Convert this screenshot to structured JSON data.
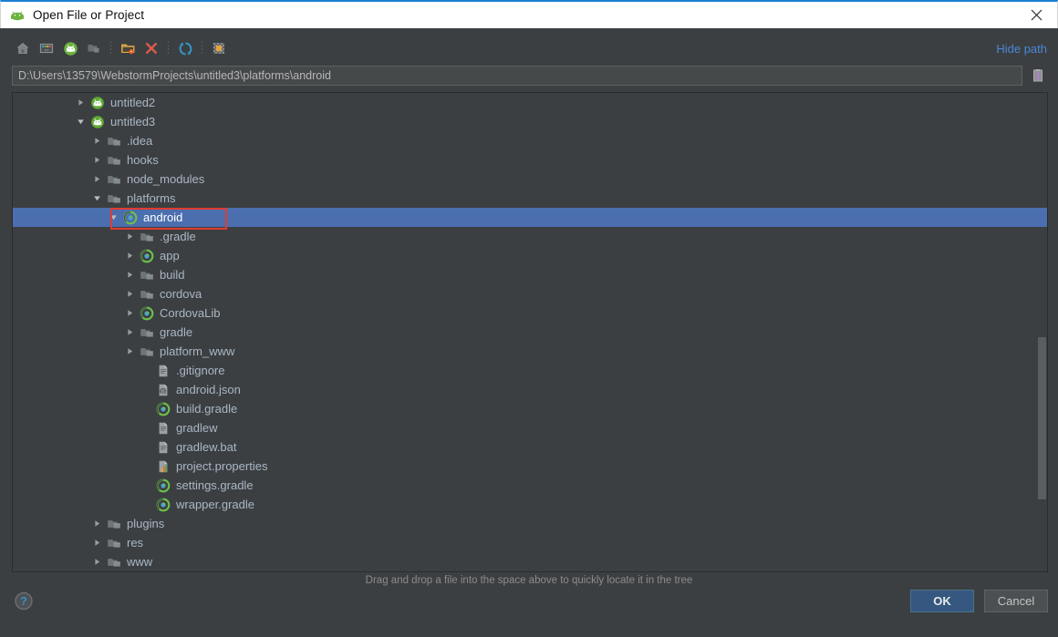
{
  "window": {
    "title": "Open File or Project",
    "app_icon": "android-icon",
    "close_icon": "close-icon",
    "accent_blue": "#1a7fd4"
  },
  "toolbar": {
    "buttons": [
      {
        "name": "home-icon",
        "tooltip": "Home"
      },
      {
        "name": "desktop-icon",
        "tooltip": "Desktop"
      },
      {
        "name": "android-project-icon",
        "tooltip": "Project Directory"
      },
      {
        "name": "folder-icon",
        "tooltip": "Module Directory"
      },
      {
        "name": "new-folder-icon",
        "tooltip": "New Folder"
      },
      {
        "name": "delete-icon",
        "tooltip": "Delete"
      },
      {
        "name": "refresh-icon",
        "tooltip": "Refresh"
      },
      {
        "name": "show-hidden-files-icon",
        "tooltip": "Show Hidden Files and Directories"
      }
    ],
    "hide_path_label": "Hide path"
  },
  "path": {
    "value": "D:\\Users\\13579\\WebstormProjects\\untitled3\\platforms\\android",
    "placeholder": "",
    "paste_icon": "paste-from-clipboard-icon"
  },
  "tree": {
    "rows": [
      {
        "label": "untitled2",
        "indent": 4,
        "arrow": "collapsed",
        "icon": "android-module-icon",
        "selected": false
      },
      {
        "label": "untitled3",
        "indent": 4,
        "arrow": "expanded",
        "icon": "android-module-icon",
        "selected": false
      },
      {
        "label": ".idea",
        "indent": 5,
        "arrow": "collapsed",
        "icon": "folder-icon",
        "selected": false
      },
      {
        "label": "hooks",
        "indent": 5,
        "arrow": "collapsed",
        "icon": "folder-icon",
        "selected": false
      },
      {
        "label": "node_modules",
        "indent": 5,
        "arrow": "collapsed",
        "icon": "folder-icon",
        "selected": false
      },
      {
        "label": "platforms",
        "indent": 5,
        "arrow": "expanded",
        "icon": "folder-icon",
        "selected": false
      },
      {
        "label": "android",
        "indent": 6,
        "arrow": "expanded",
        "icon": "gradle-icon",
        "selected": true
      },
      {
        "label": ".gradle",
        "indent": 7,
        "arrow": "collapsed",
        "icon": "folder-icon",
        "selected": false
      },
      {
        "label": "app",
        "indent": 7,
        "arrow": "collapsed",
        "icon": "gradle-icon",
        "selected": false
      },
      {
        "label": "build",
        "indent": 7,
        "arrow": "collapsed",
        "icon": "folder-icon",
        "selected": false
      },
      {
        "label": "cordova",
        "indent": 7,
        "arrow": "collapsed",
        "icon": "folder-icon",
        "selected": false
      },
      {
        "label": "CordovaLib",
        "indent": 7,
        "arrow": "collapsed",
        "icon": "gradle-icon",
        "selected": false
      },
      {
        "label": "gradle",
        "indent": 7,
        "arrow": "collapsed",
        "icon": "folder-icon",
        "selected": false
      },
      {
        "label": "platform_www",
        "indent": 7,
        "arrow": "collapsed",
        "icon": "folder-icon",
        "selected": false
      },
      {
        "label": ".gitignore",
        "indent": 8,
        "arrow": "none",
        "icon": "text-file-icon",
        "selected": false
      },
      {
        "label": "android.json",
        "indent": 8,
        "arrow": "none",
        "icon": "json-file-icon",
        "selected": false
      },
      {
        "label": "build.gradle",
        "indent": 8,
        "arrow": "none",
        "icon": "gradle-icon",
        "selected": false
      },
      {
        "label": "gradlew",
        "indent": 8,
        "arrow": "none",
        "icon": "text-file-icon",
        "selected": false
      },
      {
        "label": "gradlew.bat",
        "indent": 8,
        "arrow": "none",
        "icon": "text-file-icon",
        "selected": false
      },
      {
        "label": "project.properties",
        "indent": 8,
        "arrow": "none",
        "icon": "properties-file-icon",
        "selected": false
      },
      {
        "label": "settings.gradle",
        "indent": 8,
        "arrow": "none",
        "icon": "gradle-icon",
        "selected": false
      },
      {
        "label": "wrapper.gradle",
        "indent": 8,
        "arrow": "none",
        "icon": "gradle-icon",
        "selected": false
      },
      {
        "label": "plugins",
        "indent": 5,
        "arrow": "collapsed",
        "icon": "folder-icon",
        "selected": false
      },
      {
        "label": "res",
        "indent": 5,
        "arrow": "collapsed",
        "icon": "folder-icon",
        "selected": false
      },
      {
        "label": "www",
        "indent": 5,
        "arrow": "collapsed",
        "icon": "folder-icon",
        "selected": false
      }
    ],
    "annotation_color": "#e13b30",
    "selection_color": "#4b6eaf"
  },
  "hint": "Drag and drop a file into the space above to quickly locate it in the tree",
  "footer": {
    "help_icon": "help-icon",
    "ok_label": "OK",
    "cancel_label": "Cancel"
  }
}
